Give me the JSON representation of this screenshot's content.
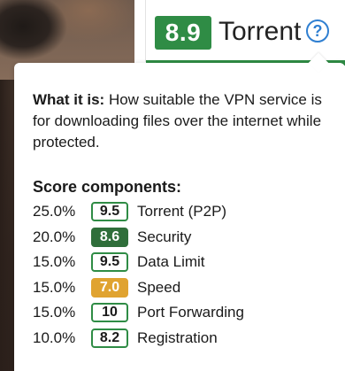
{
  "header": {
    "score": "8.9",
    "label": "Torrent",
    "help_glyph": "?",
    "accent_color": "#2f8c45"
  },
  "tooltip": {
    "what_label": "What it is:",
    "what_text": " How suitable the VPN service is for downloading files over the internet while protected.",
    "components_title": "Score components:",
    "components": [
      {
        "weight": "25.0%",
        "score": "9.5",
        "name": "Torrent (P2P)",
        "style": "outline",
        "color": "#2f8c45"
      },
      {
        "weight": "20.0%",
        "score": "8.6",
        "name": "Security",
        "style": "solid",
        "color": "#2f6e3a"
      },
      {
        "weight": "15.0%",
        "score": "9.5",
        "name": "Data Limit",
        "style": "outline",
        "color": "#2f8c45"
      },
      {
        "weight": "15.0%",
        "score": "7.0",
        "name": "Speed",
        "style": "solid",
        "color": "#e0a330"
      },
      {
        "weight": "15.0%",
        "score": "10",
        "name": "Port Forwarding",
        "style": "outline",
        "color": "#2f8c45"
      },
      {
        "weight": "10.0%",
        "score": "8.2",
        "name": "Registration",
        "style": "outline",
        "color": "#2f8c45"
      }
    ]
  }
}
